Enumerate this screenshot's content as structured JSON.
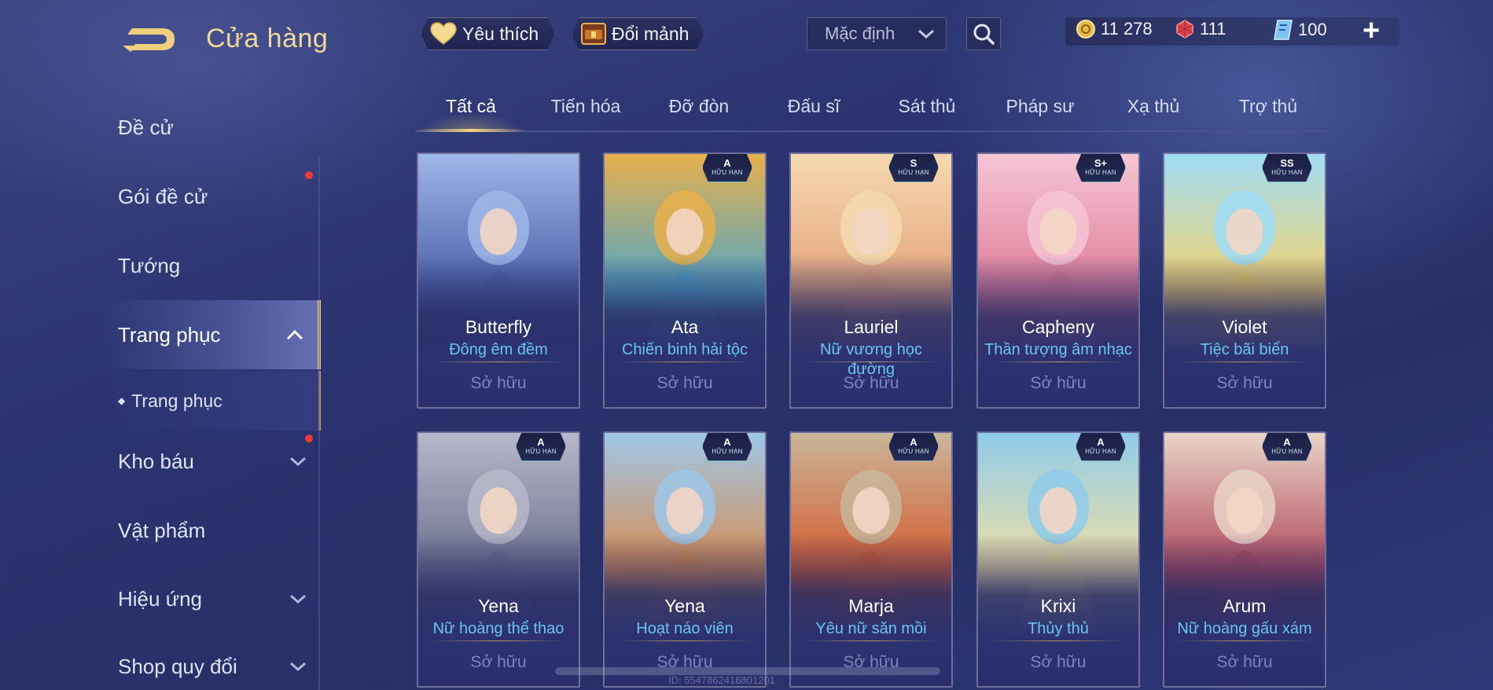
{
  "header": {
    "title": "Cửa hàng",
    "favorite_label": "Yêu thích",
    "exchange_label": "Đổi mảnh",
    "sort_value": "Mặc định"
  },
  "currency": {
    "gold": "11 278",
    "ruby": "111",
    "voucher": "100"
  },
  "sidebar": {
    "items": [
      {
        "label": "Đề cử",
        "dot": false
      },
      {
        "label": "Gói đề cử",
        "dot": true
      },
      {
        "label": "Tướng",
        "dot": false
      },
      {
        "label": "Trang phục",
        "expanded": true
      },
      {
        "label": "Trang phục",
        "sub": true
      },
      {
        "label": "Kho báu",
        "dot": true,
        "chevron": true
      },
      {
        "label": "Vật phẩm"
      },
      {
        "label": "Hiệu ứng",
        "chevron": true
      },
      {
        "label": "Shop quy đổi",
        "chevron": true
      }
    ]
  },
  "tabs": [
    "Tất cả",
    "Tiến hóa",
    "Đỡ đòn",
    "Đấu sĩ",
    "Sát thủ",
    "Pháp sư",
    "Xạ thủ",
    "Trợ thủ"
  ],
  "cards": [
    {
      "hero": "Butterfly",
      "skin": "Đông êm đềm",
      "status": "Sở hữu",
      "rank": "",
      "limited": ""
    },
    {
      "hero": "Ata",
      "skin": "Chiến binh hải tộc",
      "status": "Sở hữu",
      "rank": "A",
      "limited": "HỮU HẠN"
    },
    {
      "hero": "Lauriel",
      "skin": "Nữ vương học đường",
      "status": "Sở hữu",
      "rank": "S",
      "limited": "HỮU HẠN"
    },
    {
      "hero": "Capheny",
      "skin": "Thần tượng âm nhạc",
      "status": "Sở hữu",
      "rank": "S+",
      "limited": "HỮU HẠN"
    },
    {
      "hero": "Violet",
      "skin": "Tiệc bãi biển",
      "status": "Sở hữu",
      "rank": "SS",
      "limited": "HỮU HẠN"
    },
    {
      "hero": "Yena",
      "skin": "Nữ hoàng thể thao",
      "status": "Sở hữu",
      "rank": "A",
      "limited": "HỮU HẠN"
    },
    {
      "hero": "Yena",
      "skin": "Hoạt náo viên",
      "status": "Sở hữu",
      "rank": "A",
      "limited": "HỮU HẠN"
    },
    {
      "hero": "Marja",
      "skin": "Yêu nữ săn mồi",
      "status": "Sở hữu",
      "rank": "A",
      "limited": "HỮU HẠN"
    },
    {
      "hero": "Krixi",
      "skin": "Thủy thủ",
      "status": "Sở hữu",
      "rank": "A",
      "limited": "HỮU HẠN"
    },
    {
      "hero": "Arum",
      "skin": "Nữ hoàng gấu xám",
      "status": "Sở hữu",
      "rank": "A",
      "limited": "HỮU HẠN"
    }
  ],
  "footer_text": "ID: 5547862416801201",
  "colors": {
    "accent_gold": "#f1d89a",
    "skin_name": "#69c5f0",
    "owned_text": "#7e86b8",
    "notification": "#ea3b3b"
  }
}
